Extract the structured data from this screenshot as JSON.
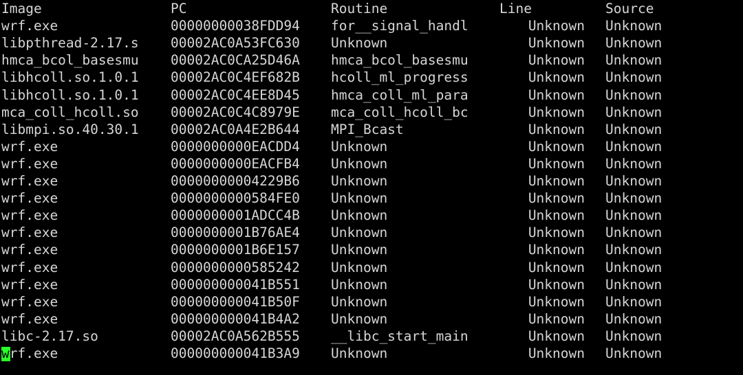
{
  "terminal": {
    "background_color": "#000000",
    "foreground_color": "#d6d6d6",
    "cursor_color": "#2aff2a",
    "cursor_text_color": "#000000",
    "cursor_row_index": 20,
    "cursor_char": "w"
  },
  "table": {
    "headers": {
      "image": "Image",
      "pc": "PC",
      "routine": "Routine",
      "line": "Line",
      "source": "Source"
    },
    "rows": [
      {
        "image": "wrf.exe",
        "pc": "00000000038FDD94",
        "routine": "for__signal_handl",
        "line": "Unknown",
        "source": "Unknown"
      },
      {
        "image": "libpthread-2.17.s",
        "pc": "00002AC0A53FC630",
        "routine": "Unknown",
        "line": "Unknown",
        "source": "Unknown"
      },
      {
        "image": "hmca_bcol_basesmu",
        "pc": "00002AC0CA25D46A",
        "routine": "hmca_bcol_basesmu",
        "line": "Unknown",
        "source": "Unknown"
      },
      {
        "image": "libhcoll.so.1.0.1",
        "pc": "00002AC0C4EF682B",
        "routine": "hcoll_ml_progress",
        "line": "Unknown",
        "source": "Unknown"
      },
      {
        "image": "libhcoll.so.1.0.1",
        "pc": "00002AC0C4EE8D45",
        "routine": "hmca_coll_ml_para",
        "line": "Unknown",
        "source": "Unknown"
      },
      {
        "image": "mca_coll_hcoll.so",
        "pc": "00002AC0C4C8979E",
        "routine": "mca_coll_hcoll_bc",
        "line": "Unknown",
        "source": "Unknown"
      },
      {
        "image": "libmpi.so.40.30.1",
        "pc": "00002AC0A4E2B644",
        "routine": "MPI_Bcast",
        "line": "Unknown",
        "source": "Unknown"
      },
      {
        "image": "wrf.exe",
        "pc": "0000000000EACDD4",
        "routine": "Unknown",
        "line": "Unknown",
        "source": "Unknown"
      },
      {
        "image": "wrf.exe",
        "pc": "0000000000EACFB4",
        "routine": "Unknown",
        "line": "Unknown",
        "source": "Unknown"
      },
      {
        "image": "wrf.exe",
        "pc": "00000000004229B6",
        "routine": "Unknown",
        "line": "Unknown",
        "source": "Unknown"
      },
      {
        "image": "wrf.exe",
        "pc": "0000000000584FE0",
        "routine": "Unknown",
        "line": "Unknown",
        "source": "Unknown"
      },
      {
        "image": "wrf.exe",
        "pc": "0000000001ADCC4B",
        "routine": "Unknown",
        "line": "Unknown",
        "source": "Unknown"
      },
      {
        "image": "wrf.exe",
        "pc": "0000000001B76AE4",
        "routine": "Unknown",
        "line": "Unknown",
        "source": "Unknown"
      },
      {
        "image": "wrf.exe",
        "pc": "0000000001B6E157",
        "routine": "Unknown",
        "line": "Unknown",
        "source": "Unknown"
      },
      {
        "image": "wrf.exe",
        "pc": "0000000000585242",
        "routine": "Unknown",
        "line": "Unknown",
        "source": "Unknown"
      },
      {
        "image": "wrf.exe",
        "pc": "000000000041B551",
        "routine": "Unknown",
        "line": "Unknown",
        "source": "Unknown"
      },
      {
        "image": "wrf.exe",
        "pc": "000000000041B50F",
        "routine": "Unknown",
        "line": "Unknown",
        "source": "Unknown"
      },
      {
        "image": "wrf.exe",
        "pc": "000000000041B4A2",
        "routine": "Unknown",
        "line": "Unknown",
        "source": "Unknown"
      },
      {
        "image": "libc-2.17.so",
        "pc": "00002AC0A562B555",
        "routine": "__libc_start_main",
        "line": "Unknown",
        "source": "Unknown"
      },
      {
        "image": "wrf.exe",
        "pc": "000000000041B3A9",
        "routine": "Unknown",
        "line": "Unknown",
        "source": "Unknown"
      }
    ]
  }
}
